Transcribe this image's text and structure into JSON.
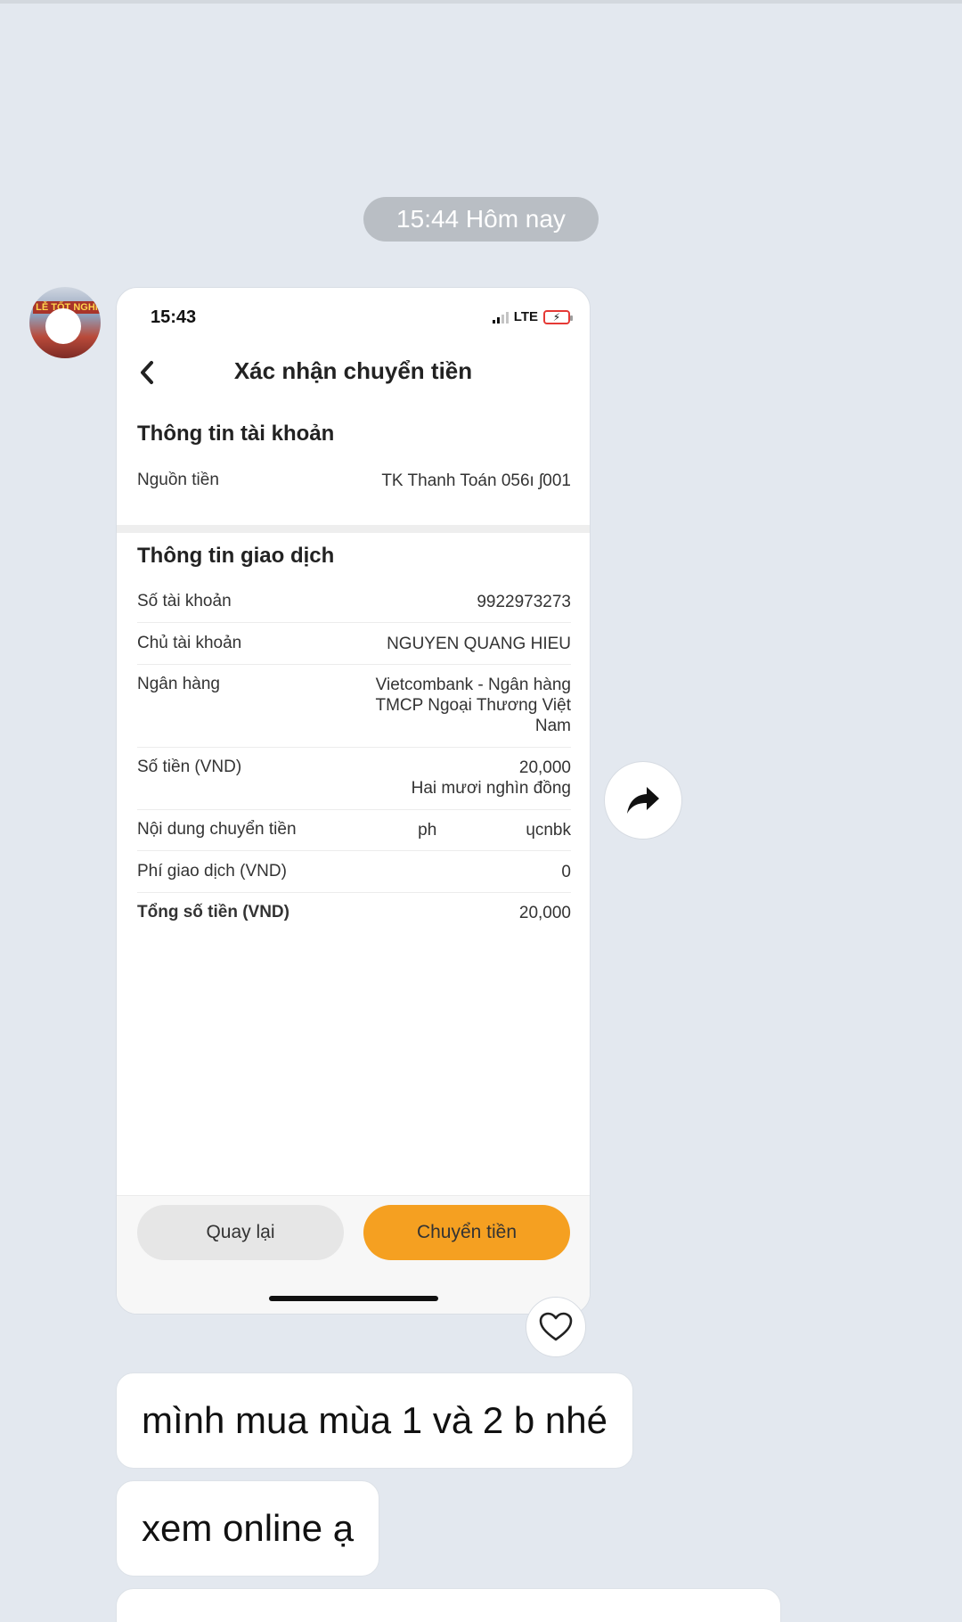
{
  "chat": {
    "timestamp_chip": "15:44 Hôm nay",
    "avatar_banner": "LỄ TỐT NGHI",
    "messages": [
      {
        "text": "mình mua mùa 1 và 2 b nhé"
      },
      {
        "text": "xem online ạ"
      },
      {
        "text": ""
      }
    ]
  },
  "shot": {
    "status": {
      "time": "15:43",
      "network": "LTE"
    },
    "nav_title": "Xác nhận chuyển tiền",
    "account_section": {
      "title": "Thông tin tài khoản",
      "source_label": "Nguồn tiền",
      "source_value": "TK Thanh Toán 056ı     ʃ001"
    },
    "transaction_section": {
      "title": "Thông tin giao dịch",
      "rows": [
        {
          "label": "Số tài khoản",
          "value": "9922973273"
        },
        {
          "label": "Chủ tài khoản",
          "value": "NGUYEN QUANG HIEU"
        },
        {
          "label": "Ngân hàng",
          "value_line1": "Vietcombank - Ngân hàng",
          "value_line2": "TMCP Ngoại Thương Việt",
          "value_line3": "Nam"
        },
        {
          "label": "Số tiền (VND)",
          "value_line1": "20,000",
          "value_line2": "Hai mươi nghìn đồng"
        },
        {
          "label": "Nội dung chuyển tiền",
          "value_part1": "ph",
          "value_part2": "ɥcnbk"
        },
        {
          "label": "Phí giao dịch (VND)",
          "value": "0"
        },
        {
          "label": "Tổng số tiền (VND)",
          "value": "20,000"
        }
      ]
    },
    "buttons": {
      "back": "Quay lại",
      "send": "Chuyển tiền"
    }
  },
  "icons": {
    "share": "share-arrow-icon",
    "react": "heart-outline-icon",
    "back": "chevron-left-icon",
    "battery_charging_color": "#e53935",
    "accent_orange": "#f5a021"
  }
}
